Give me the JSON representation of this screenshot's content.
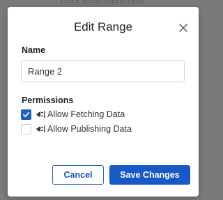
{
  "backdrop": {
    "text": "Dock dimensions here"
  },
  "dialog": {
    "title": "Edit Range",
    "close_icon": "close-icon"
  },
  "name_section": {
    "label": "Name",
    "value": "Range 2",
    "placeholder": ""
  },
  "permissions": {
    "label": "Permissions",
    "items": [
      {
        "label": "Allow Fetching Data",
        "checked": true,
        "icon": "plug-icon"
      },
      {
        "label": "Allow Publishing Data",
        "checked": false,
        "icon": "plug-icon"
      }
    ]
  },
  "buttons": {
    "cancel": "Cancel",
    "save": "Save Changes"
  },
  "colors": {
    "accent": "#1659c7",
    "backdrop": "#7b7b7b",
    "dialog_bg": "#ffffff"
  }
}
